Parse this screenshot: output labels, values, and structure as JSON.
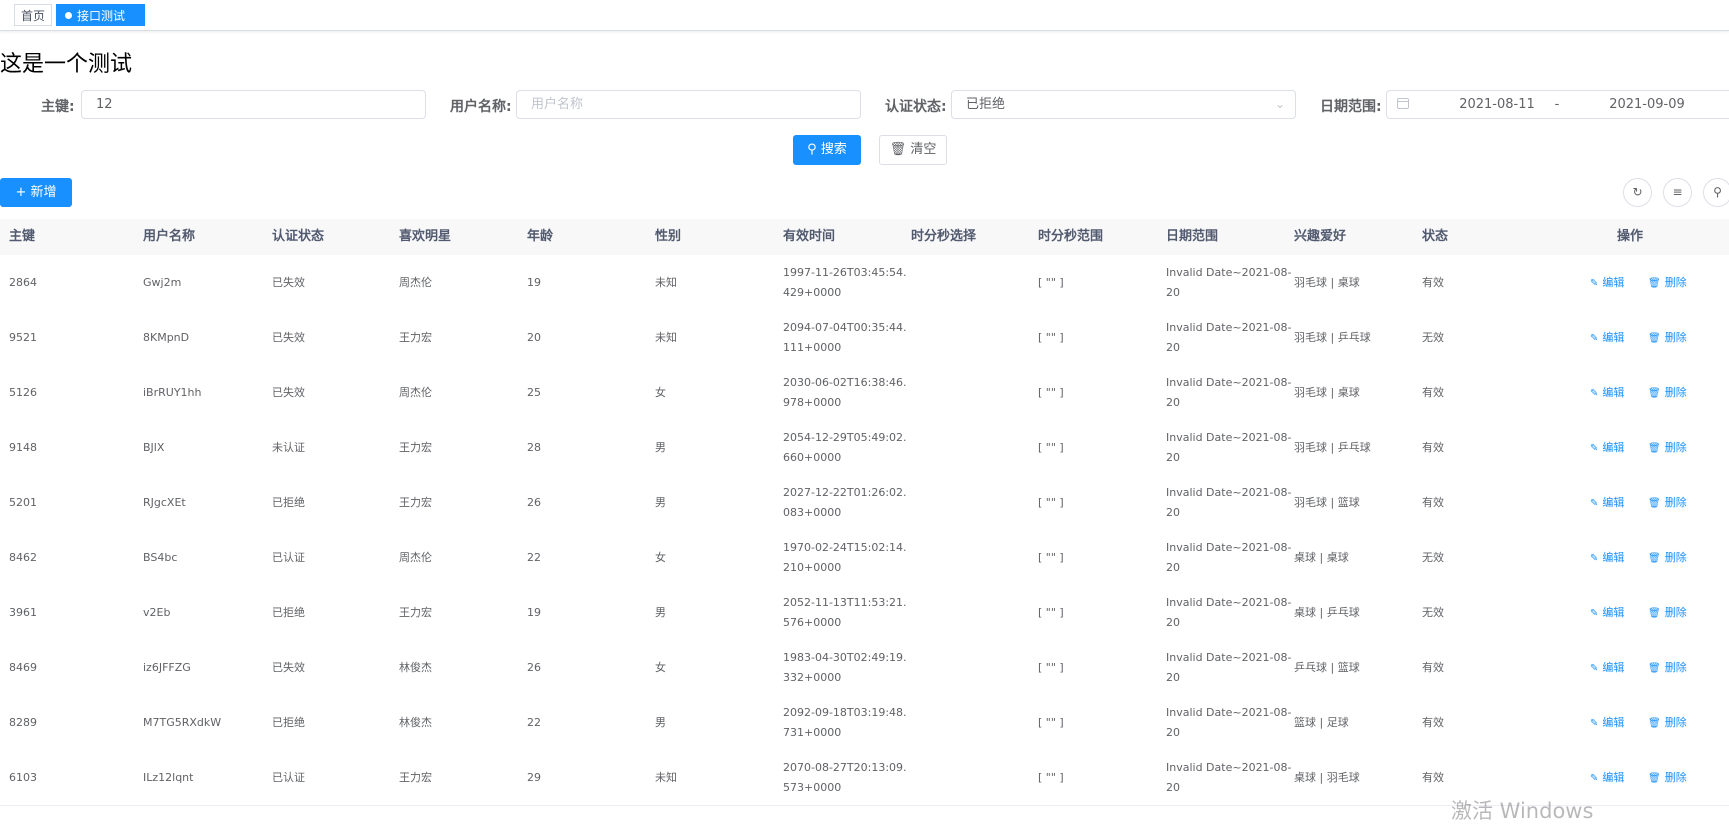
{
  "tabs": {
    "home": "首页",
    "active": "接口测试",
    "close": "×"
  },
  "page_title": "这是一个测试",
  "form": {
    "pk_label": "主键:",
    "pk_value": "12",
    "username_label": "用户名称:",
    "username_placeholder": "用户名称",
    "auth_label": "认证状态:",
    "auth_value": "已拒绝",
    "date_label": "日期范围:",
    "date_start": "2021-08-11",
    "date_sep": "-",
    "date_end": "2021-09-09"
  },
  "buttons": {
    "search": "搜索",
    "clear": "清空",
    "add": "新增"
  },
  "table": {
    "headers": [
      "主键",
      "用户名称",
      "认证状态",
      "喜欢明星",
      "年龄",
      "性别",
      "有效时间",
      "时分秒选择",
      "时分秒范围",
      "日期范围",
      "兴趣爱好",
      "状态",
      "操作"
    ],
    "edit_label": "编辑",
    "delete_label": "删除",
    "rows": [
      {
        "id": "2864",
        "name": "Gwj2m",
        "auth": "已失效",
        "star": "周杰伦",
        "age": "19",
        "gender": "未知",
        "time1": "1997-11-26T03:45:54.",
        "time2": "429+0000",
        "hms": "",
        "hms_range": "[ \"\" ]",
        "date1": "Invalid Date~2021-08-",
        "date2": "20",
        "hobby": "羽毛球 | 桌球",
        "status": "有效"
      },
      {
        "id": "9521",
        "name": "8KMpnD",
        "auth": "已失效",
        "star": "王力宏",
        "age": "20",
        "gender": "未知",
        "time1": "2094-07-04T00:35:44.",
        "time2": "111+0000",
        "hms": "",
        "hms_range": "[ \"\" ]",
        "date1": "Invalid Date~2021-08-",
        "date2": "20",
        "hobby": "羽毛球 | 乒乓球",
        "status": "无效"
      },
      {
        "id": "5126",
        "name": "iBrRUY1hh",
        "auth": "已失效",
        "star": "周杰伦",
        "age": "25",
        "gender": "女",
        "time1": "2030-06-02T16:38:46.",
        "time2": "978+0000",
        "hms": "",
        "hms_range": "[ \"\" ]",
        "date1": "Invalid Date~2021-08-",
        "date2": "20",
        "hobby": "羽毛球 | 桌球",
        "status": "有效"
      },
      {
        "id": "9148",
        "name": "BJlX",
        "auth": "未认证",
        "star": "王力宏",
        "age": "28",
        "gender": "男",
        "time1": "2054-12-29T05:49:02.",
        "time2": "660+0000",
        "hms": "",
        "hms_range": "[ \"\" ]",
        "date1": "Invalid Date~2021-08-",
        "date2": "20",
        "hobby": "羽毛球 | 乒乓球",
        "status": "有效"
      },
      {
        "id": "5201",
        "name": "RJgcXEt",
        "auth": "已拒绝",
        "star": "王力宏",
        "age": "26",
        "gender": "男",
        "time1": "2027-12-22T01:26:02.",
        "time2": "083+0000",
        "hms": "",
        "hms_range": "[ \"\" ]",
        "date1": "Invalid Date~2021-08-",
        "date2": "20",
        "hobby": "羽毛球 | 篮球",
        "status": "有效"
      },
      {
        "id": "8462",
        "name": "BS4bc",
        "auth": "已认证",
        "star": "周杰伦",
        "age": "22",
        "gender": "女",
        "time1": "1970-02-24T15:02:14.",
        "time2": "210+0000",
        "hms": "",
        "hms_range": "[ \"\" ]",
        "date1": "Invalid Date~2021-08-",
        "date2": "20",
        "hobby": "桌球 | 桌球",
        "status": "无效"
      },
      {
        "id": "3961",
        "name": "v2Eb",
        "auth": "已拒绝",
        "star": "王力宏",
        "age": "19",
        "gender": "男",
        "time1": "2052-11-13T11:53:21.",
        "time2": "576+0000",
        "hms": "",
        "hms_range": "[ \"\" ]",
        "date1": "Invalid Date~2021-08-",
        "date2": "20",
        "hobby": "桌球 | 乒乓球",
        "status": "无效"
      },
      {
        "id": "8469",
        "name": "iz6JFFZG",
        "auth": "已失效",
        "star": "林俊杰",
        "age": "26",
        "gender": "女",
        "time1": "1983-04-30T02:49:19.",
        "time2": "332+0000",
        "hms": "",
        "hms_range": "[ \"\" ]",
        "date1": "Invalid Date~2021-08-",
        "date2": "20",
        "hobby": "乒乓球 | 篮球",
        "status": "有效"
      },
      {
        "id": "8289",
        "name": "M7TG5RXdkW",
        "auth": "已拒绝",
        "star": "林俊杰",
        "age": "22",
        "gender": "男",
        "time1": "2092-09-18T03:19:48.",
        "time2": "731+0000",
        "hms": "",
        "hms_range": "[ \"\" ]",
        "date1": "Invalid Date~2021-08-",
        "date2": "20",
        "hobby": "篮球 | 足球",
        "status": "有效"
      },
      {
        "id": "6103",
        "name": "ILz12lqnt",
        "auth": "已认证",
        "star": "王力宏",
        "age": "29",
        "gender": "未知",
        "time1": "2070-08-27T20:13:09.",
        "time2": "573+0000",
        "hms": "",
        "hms_range": "[ \"\" ]",
        "date1": "Invalid Date~2021-08-",
        "date2": "20",
        "hobby": "桌球 | 羽毛球",
        "status": "有效"
      }
    ]
  },
  "watermark": "激活 Windows"
}
